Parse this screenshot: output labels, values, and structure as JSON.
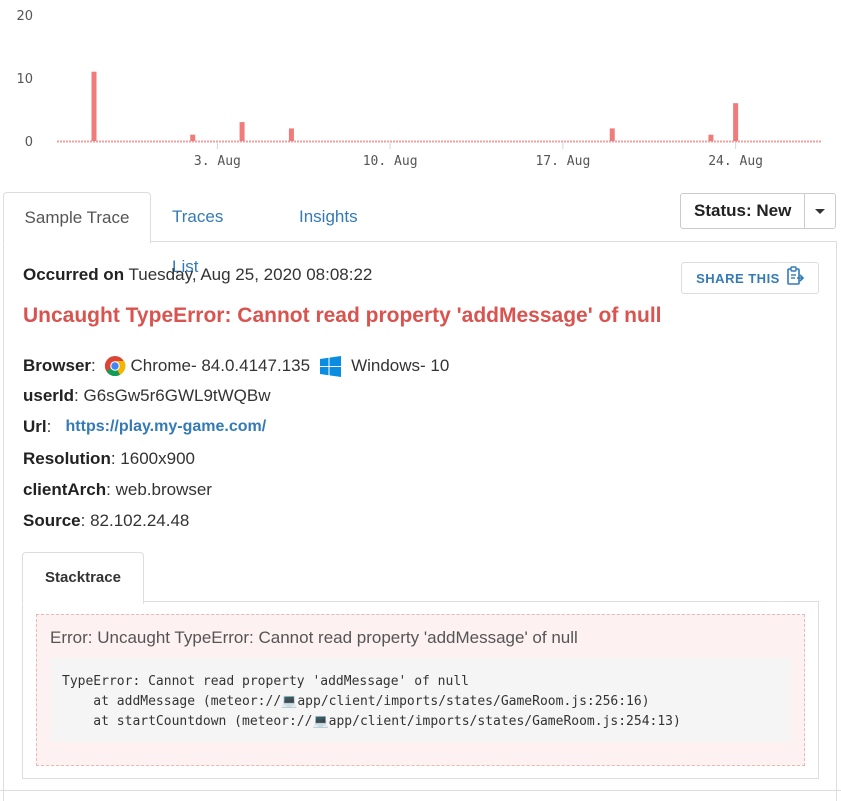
{
  "chart_data": {
    "type": "bar",
    "x_tick_labels": [
      "3. Aug",
      "10. Aug",
      "17. Aug",
      "24. Aug"
    ],
    "y_tick_labels": [
      "0",
      "10",
      "20"
    ],
    "ylim": [
      0,
      20
    ],
    "color": "#ef7b7b",
    "categories": [
      "Jul 28",
      "Jul 29",
      "Jul 30",
      "Jul 31",
      "Aug 1",
      "Aug 2",
      "Aug 3",
      "Aug 4",
      "Aug 5",
      "Aug 6",
      "Aug 7",
      "Aug 8",
      "Aug 9",
      "Aug 10",
      "Aug 11",
      "Aug 12",
      "Aug 13",
      "Aug 14",
      "Aug 15",
      "Aug 16",
      "Aug 17",
      "Aug 18",
      "Aug 19",
      "Aug 20",
      "Aug 21",
      "Aug 22",
      "Aug 23",
      "Aug 24",
      "Aug 25",
      "Aug 26",
      "Aug 27"
    ],
    "values": [
      0,
      11,
      0,
      0,
      0,
      1,
      0,
      3,
      0,
      2,
      0,
      0,
      0,
      0,
      0,
      0,
      0,
      0,
      0,
      0,
      0,
      0,
      2,
      0,
      0,
      0,
      1,
      6,
      0,
      0,
      0
    ]
  },
  "tabs": {
    "sample_trace": "Sample Trace",
    "traces_list": "Traces List",
    "insights": "Insights"
  },
  "status": {
    "label": "Status: New"
  },
  "occurred": {
    "label": "Occurred on",
    "value": " Tuesday, Aug 25, 2020 08:08:22"
  },
  "share": {
    "label": "SHARE THIS"
  },
  "error_title": "Uncaught TypeError: Cannot read property 'addMessage' of null",
  "details": {
    "browser_label": "Browser",
    "browser_name": "Chrome",
    "browser_version": " - 84.0.4147.135",
    "os_name": "Windows",
    "os_version": " - 10",
    "userid_label": "userId",
    "userid_value": "G6sGw5r6GWL9tWQBw",
    "url_label": "Url",
    "url_value": "https://play.my-game.com/",
    "resolution_label": "Resolution",
    "resolution_value": "1600x900",
    "clientarch_label": "clientArch",
    "clientarch_value": "web.browser",
    "source_label": "Source",
    "source_value": "82.102.24.48"
  },
  "stacktrace": {
    "tab_label": "Stacktrace",
    "error_heading": "Error: Uncaught TypeError: Cannot read property 'addMessage' of null",
    "lines": "TypeError: Cannot read property 'addMessage' of null\n    at addMessage (meteor://💻app/client/imports/states/GameRoom.js:256:16)\n    at startCountdown (meteor://💻app/client/imports/states/GameRoom.js:254:13)"
  }
}
